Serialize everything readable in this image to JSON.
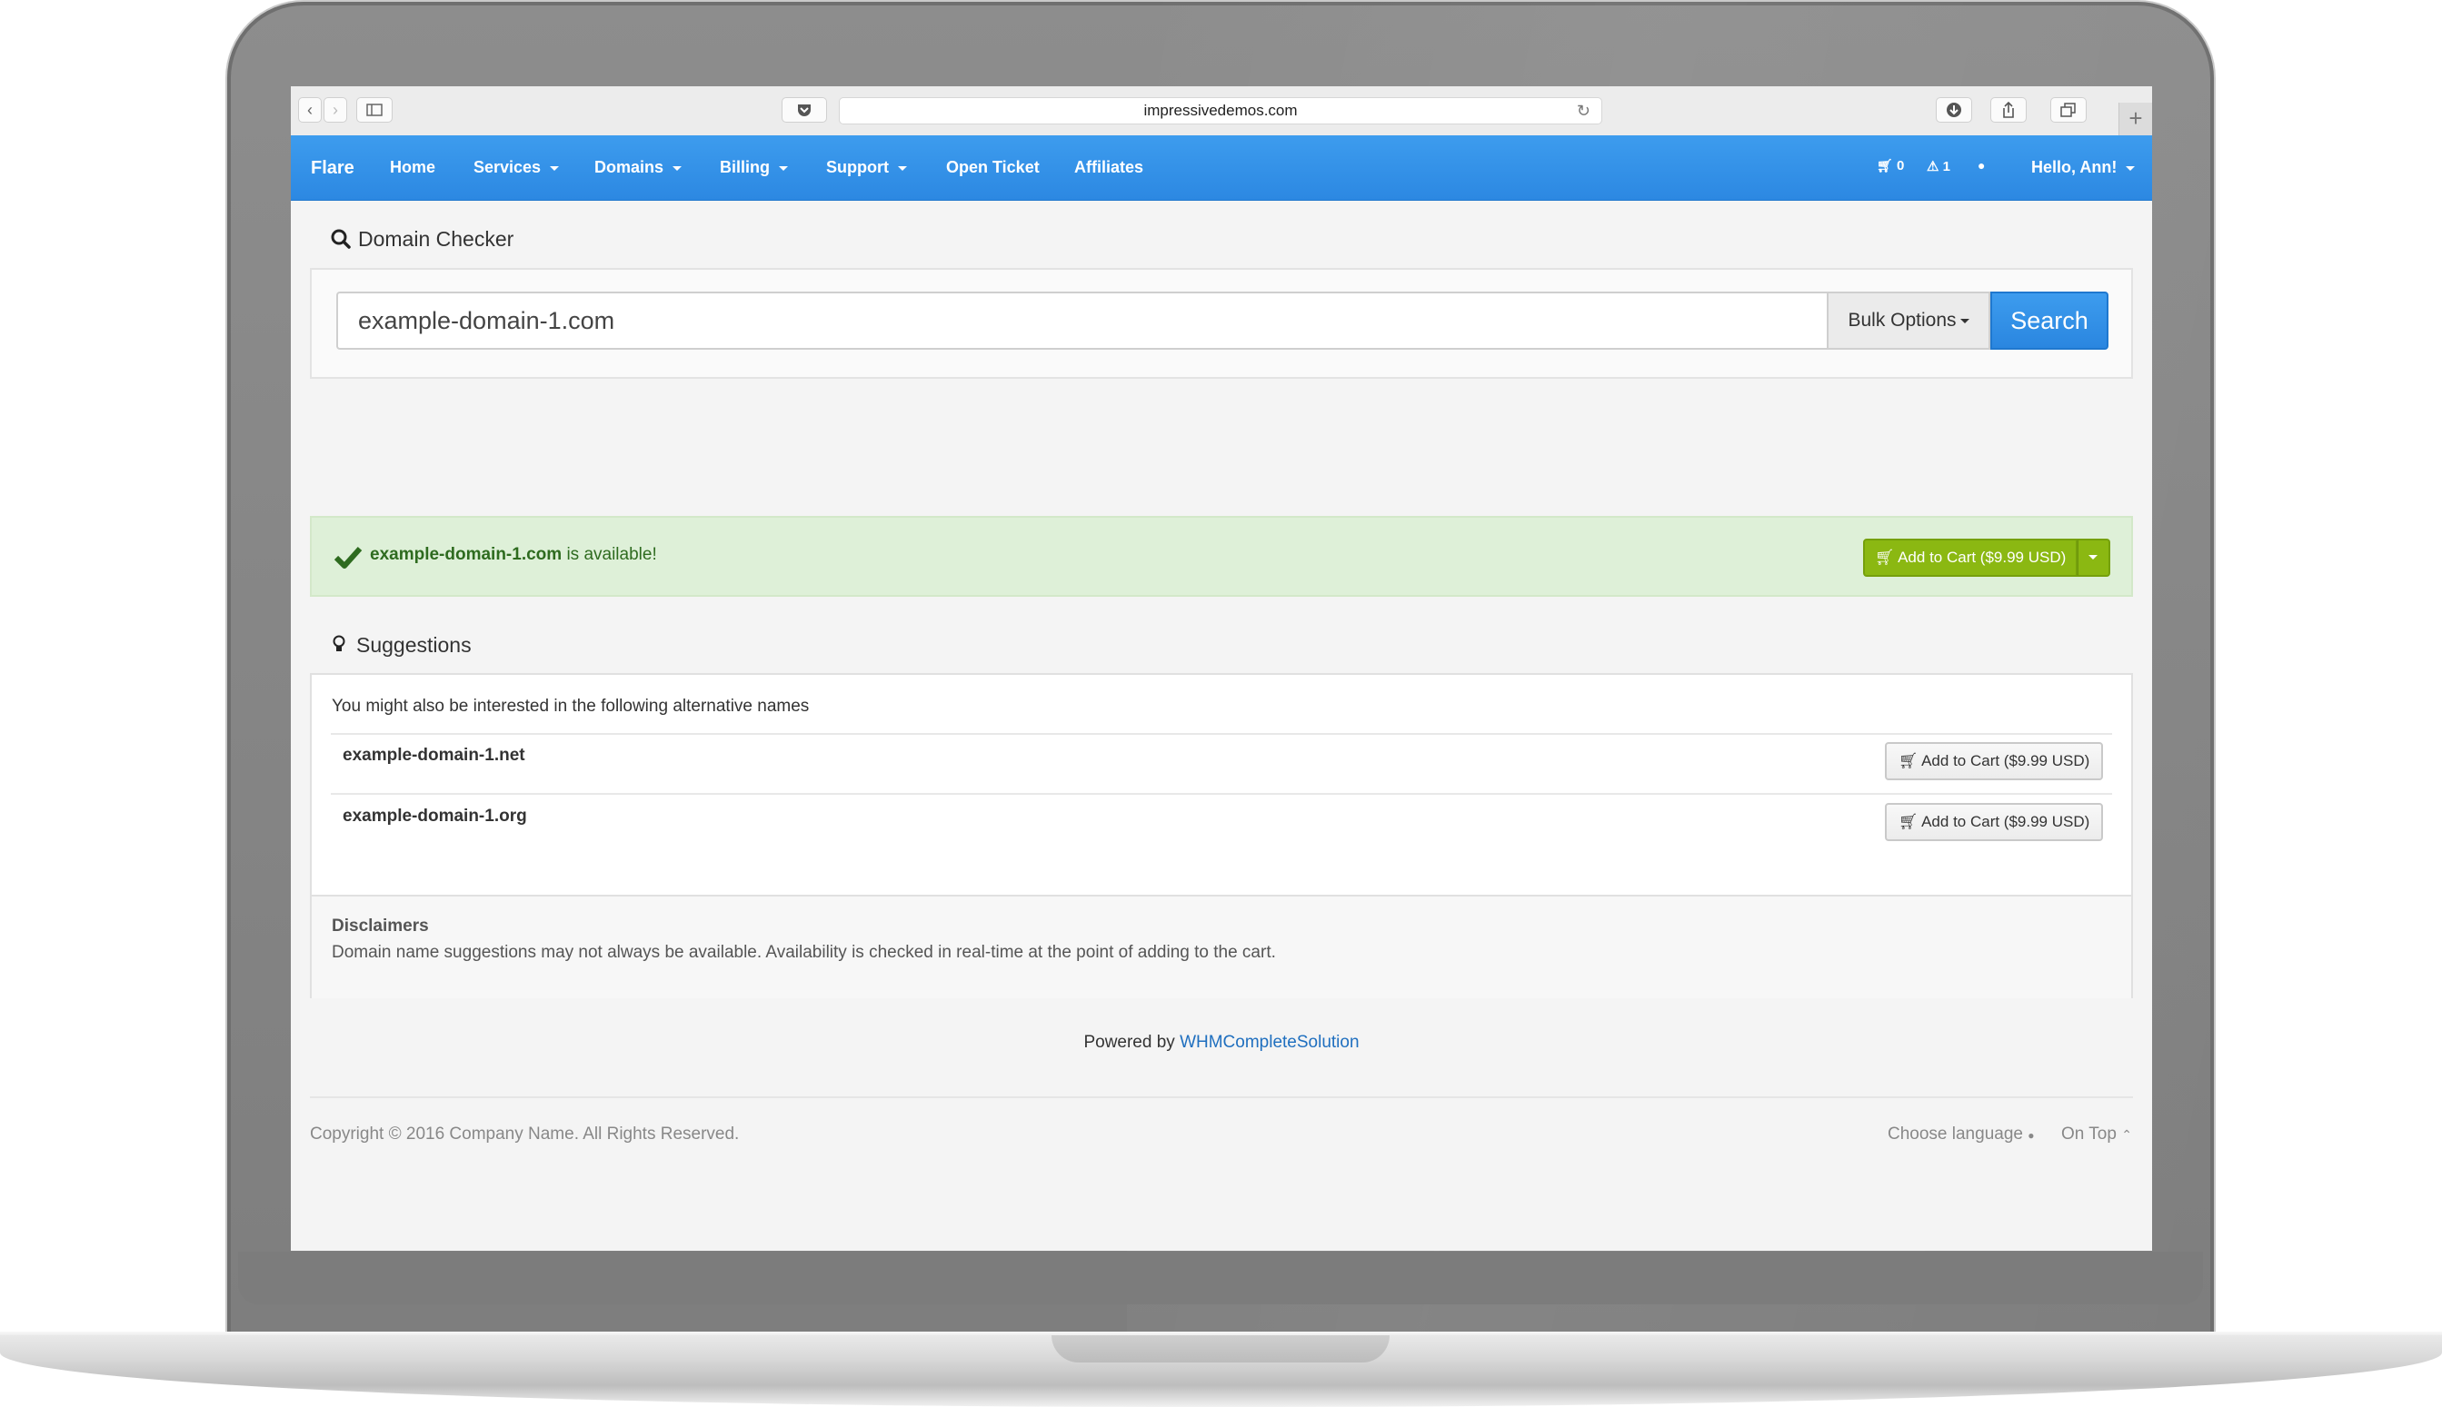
{
  "browser": {
    "url": "impressivedemos.com"
  },
  "nav": {
    "brand": "Flare",
    "items": [
      {
        "label": "Home",
        "caret": false
      },
      {
        "label": "Services",
        "caret": true
      },
      {
        "label": "Domains",
        "caret": true
      },
      {
        "label": "Billing",
        "caret": true
      },
      {
        "label": "Support",
        "caret": true
      },
      {
        "label": "Open Ticket",
        "caret": false
      },
      {
        "label": "Affiliates",
        "caret": false
      }
    ],
    "cart_count": "0",
    "alert_count": "1",
    "greeting": "Hello, Ann!"
  },
  "domain_checker": {
    "title": "Domain Checker",
    "query": "example-domain-1.com",
    "bulk_label": "Bulk Options",
    "search_label": "Search"
  },
  "result": {
    "domain": "example-domain-1.com",
    "status_text": "is available!",
    "add_label": "Add to Cart ($9.99 USD)"
  },
  "suggestions": {
    "title": "Suggestions",
    "intro": "You might also be interested in the following alternative names",
    "items": [
      {
        "domain": "example-domain-1.net",
        "add_label": "Add to Cart ($9.99 USD)"
      },
      {
        "domain": "example-domain-1.org",
        "add_label": "Add to Cart ($9.99 USD)"
      }
    ],
    "disclaimer_title": "Disclaimers",
    "disclaimer_text": "Domain name suggestions may not always be available. Availability is checked in real-time at the point of adding to the cart."
  },
  "footer": {
    "powered_prefix": "Powered by",
    "powered_link": "WHMCompleteSolution",
    "copyright": "Copyright © 2016 Company Name. All Rights Reserved.",
    "language_label": "Choose language",
    "on_top_label": "On Top"
  },
  "colors": {
    "nav_blue": "#2c88e2",
    "success_bg": "#def0d8",
    "success_text": "#2e6b1f",
    "add_green": "#8bb812",
    "link_blue": "#1f6fbf"
  }
}
